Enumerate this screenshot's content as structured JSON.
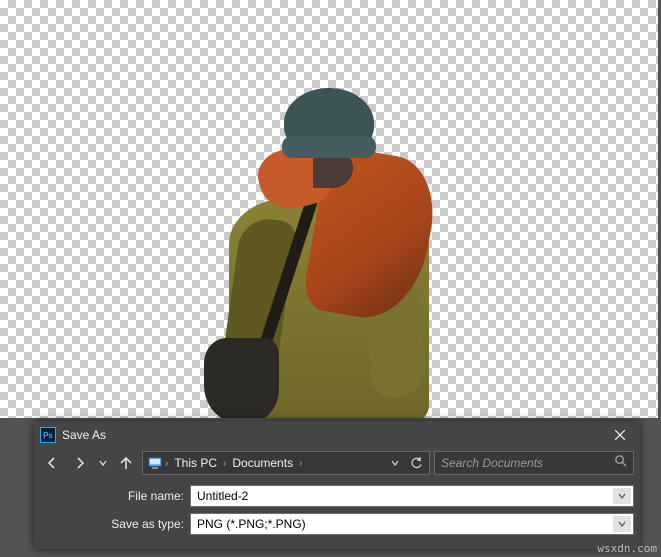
{
  "dialog": {
    "title": "Save As",
    "breadcrumb": {
      "root_icon": "pc-icon",
      "items": [
        "This PC",
        "Documents"
      ]
    },
    "search_placeholder": "Search Documents",
    "fields": {
      "filename_label": "File name:",
      "filename_value": "Untitled-2",
      "type_label": "Save as type:",
      "type_value": "PNG (*.PNG;*.PNG)"
    }
  },
  "watermark": "wsxdn.com"
}
